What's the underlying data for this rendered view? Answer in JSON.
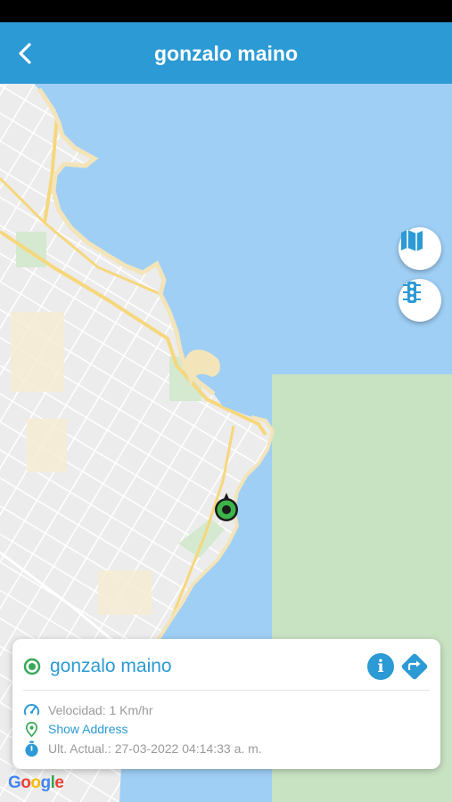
{
  "header": {
    "title": "gonzalo maino",
    "back_icon": "chevron-left-icon",
    "background_color": "#2c9ad4"
  },
  "map": {
    "controls": [
      {
        "name": "map-type-button",
        "icon": "map-icon"
      },
      {
        "name": "traffic-button",
        "icon": "traffic-light-icon"
      }
    ],
    "marker_icon": "vehicle-marker-icon",
    "attribution": "Google"
  },
  "card": {
    "name": "gonzalo maino",
    "status_icon": "online-status-icon",
    "info_icon": "info-icon",
    "directions_icon": "directions-icon",
    "speed_label": "Velocidad: 1 Km/hr",
    "address_label": "Show Address",
    "updated_label": "Ult. Actual.: 27-03-2022 04:14:33 a. m.",
    "accent_color": "#2c9ad4",
    "status_color": "#3aa95a"
  }
}
